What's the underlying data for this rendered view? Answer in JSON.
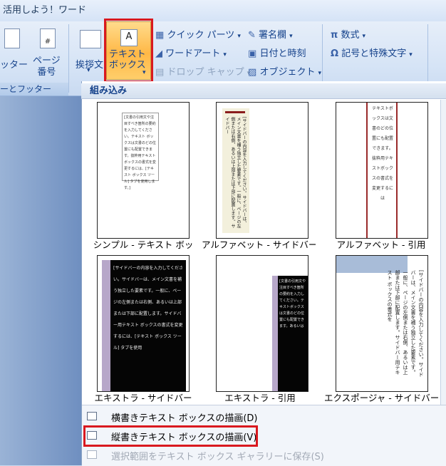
{
  "title": "活用しよう！ワード",
  "ribbon": {
    "header_footer_partial": "ッター",
    "page_number": [
      "ページ",
      "番号"
    ],
    "greeting": "挨拶文",
    "textbox": [
      "テキスト",
      "ボックス"
    ],
    "quick_parts": "クイック パーツ",
    "wordart": "ワードアート",
    "dropcap": "ドロップ キャップ",
    "signature": "署名欄",
    "datetime": "日付と時刻",
    "object": "オブジェクト",
    "equation": "数式",
    "symbol": "記号と特殊文字",
    "group_footer": "ーとフッター"
  },
  "gallery": {
    "header": "組み込み",
    "items": [
      {
        "caption": "シンプル - テキスト ボッ",
        "text": "[文書の引用文や注目すべき箇所の要約を入力してください。テキスト ボックスは文書のどの位置にも配置できます。抜粋用テキスト ボックスの書式を変更するには、[テキスト ボックス ツール] タブを使用します。]"
      },
      {
        "caption": "アルファベット - サイドバー",
        "text": "[サイドバーの内容を入力してください。サイドバーは、メイン文書を補う独立した要素です。一般に、ページの左側または右側、あるいは上部または下部に配置します。サイドバー"
      },
      {
        "caption": "アルファベット - 引用",
        "text": "テキストボックスは文書のどの位置にも配置できます。抜粋用テキストボックスの書式を変更するには"
      },
      {
        "caption": "エキストラ - サイドバー",
        "text": "[サイドバーの内容を入力してください。サイドバーは、メイン文書を補う独立した要素です。一般に、ページの左側または右側、あるいは上部または下部に配置します。サイドバー用テキスト ボックスの書式を変更するには、[テキスト ボックス ツール] タブを使用"
      },
      {
        "caption": "エキストラ - 引用",
        "text": "[文書の引用文や注目すべき箇所の要約を入力してください。テキストボックスは文書のどの位置にも配置できます。あるいは"
      },
      {
        "caption": "エクスポージャ - サイドバー",
        "text": "[サイドバーの内容を入力してください。サイドバーは、メイン文書を補う独立した要素です。一般に、ページの左側または右側、あるいは上部または下部に配置します。サイドバー用テキスト ボックスの書式を"
      }
    ]
  },
  "menu": {
    "horizontal": "横書きテキスト ボックスの描画(D)",
    "vertical": "縦書きテキスト ボックスの描画(V)",
    "save": "選択範囲をテキスト ボックス ギャラリーに保存(S)"
  }
}
